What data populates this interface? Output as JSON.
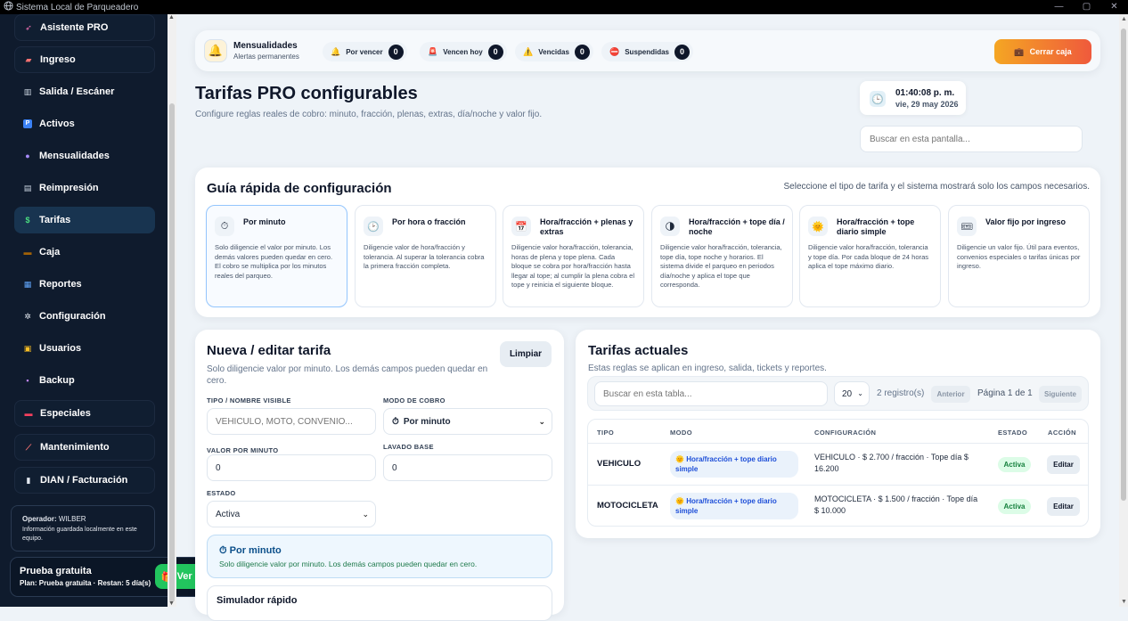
{
  "window": {
    "title": "Sistema Local de Parqueadero",
    "controls": [
      "—",
      "▢",
      "✕"
    ]
  },
  "sidebar": {
    "items": [
      {
        "label": "Asistente PRO",
        "icon": "rocket-icon"
      },
      {
        "label": "Ingreso",
        "icon": "car-icon"
      },
      {
        "label": "Salida / Escáner",
        "icon": "barcode-icon"
      },
      {
        "label": "Activos",
        "icon": "parking-icon"
      },
      {
        "label": "Mensualidades",
        "icon": "users-icon"
      },
      {
        "label": "Reimpresión",
        "icon": "printer-icon"
      },
      {
        "label": "Tarifas",
        "icon": "dollar-icon"
      },
      {
        "label": "Caja",
        "icon": "briefcase-icon"
      },
      {
        "label": "Reportes",
        "icon": "chart-icon"
      },
      {
        "label": "Configuración",
        "icon": "gear-icon"
      },
      {
        "label": "Usuarios",
        "icon": "badge-icon"
      },
      {
        "label": "Backup",
        "icon": "floppy-icon"
      },
      {
        "label": "Especiales",
        "icon": "ticket-icon"
      },
      {
        "label": "Mantenimiento",
        "icon": "broom-icon"
      },
      {
        "label": "DIAN / Facturación",
        "icon": "document-icon"
      }
    ],
    "active": "Tarifas",
    "operator": {
      "label": "Operador:",
      "name": "WILBER",
      "note": "Información guardada localmente en este equipo."
    },
    "trial": {
      "title": "Prueba gratuita",
      "detail": "Plan: Prueba gratuita · Restan: 5 día(s)",
      "button": "Ver licencia"
    }
  },
  "alerts": {
    "title": "Mensualidades",
    "subtitle": "Alertas permanentes",
    "pills": [
      {
        "label": "Por vencer",
        "count": "0"
      },
      {
        "label": "Vencen hoy",
        "count": "0"
      },
      {
        "label": "Vencidas",
        "count": "0"
      },
      {
        "label": "Suspendidas",
        "count": "0"
      }
    ],
    "close_button": "Cerrar caja"
  },
  "header": {
    "title": "Tarifas PRO configurables",
    "subtitle": "Configure reglas reales de cobro: minuto, fracción, plenas, extras, día/noche y valor fijo.",
    "time": "01:40:08 p. m.",
    "date": "vie, 29 may 2026",
    "search_placeholder": "Buscar en esta pantalla..."
  },
  "guide": {
    "title": "Guía rápida de configuración",
    "subtitle": "Seleccione el tipo de tarifa y el sistema mostrará solo los campos necesarios.",
    "options": [
      {
        "title": "Por minuto",
        "desc": "Solo diligencie el valor por minuto. Los demás valores pueden quedar en cero. El cobro se multiplica por los minutos reales del parqueo."
      },
      {
        "title": "Por hora o fracción",
        "desc": "Diligencie valor de hora/fracción y tolerancia. Al superar la tolerancia cobra la primera fracción completa."
      },
      {
        "title": "Hora/fracción + plenas y extras",
        "desc": "Diligencie valor hora/fracción, tolerancia, horas de plena y tope plena. Cada bloque se cobra por hora/fracción hasta llegar al tope; al cumplir la plena cobra el tope y reinicia el siguiente bloque."
      },
      {
        "title": "Hora/fracción + tope día / noche",
        "desc": "Diligencie valor hora/fracción, tolerancia, tope día, tope noche y horarios. El sistema divide el parqueo en periodos día/noche y aplica el tope que corresponda."
      },
      {
        "title": "Hora/fracción + tope diario simple",
        "desc": "Diligencie valor hora/fracción, tolerancia y tope día. Por cada bloque de 24 horas aplica el tope máximo diario."
      },
      {
        "title": "Valor fijo por ingreso",
        "desc": "Diligencie un valor fijo. Útil para eventos, convenios especiales o tarifas únicas por ingreso."
      }
    ]
  },
  "form": {
    "title": "Nueva / editar tarifa",
    "subtitle": "Solo diligencie valor por minuto. Los demás campos pueden quedar en cero.",
    "clear_button": "Limpiar",
    "tipo_label": "TIPO / NOMBRE VISIBLE",
    "tipo_placeholder": "VEHICULO, MOTO, CONVENIO...",
    "modo_label": "MODO DE COBRO",
    "modo_value": "Por minuto",
    "valor_label": "VALOR POR MINUTO",
    "valor_value": "0",
    "lavado_label": "LAVADO BASE",
    "lavado_value": "0",
    "estado_label": "ESTADO",
    "estado_value": "Activa",
    "hint_title": "Por minuto",
    "hint_desc": "Solo diligencie valor por minuto. Los demás campos pueden quedar en cero.",
    "simulator_title": "Simulador rápido"
  },
  "table": {
    "title": "Tarifas actuales",
    "subtitle": "Estas reglas se aplican en ingreso, salida, tickets y reportes.",
    "search_placeholder": "Buscar en esta tabla...",
    "page_size": "20",
    "records": "2 registro(s)",
    "prev": "Anterior",
    "page_info": "Página 1 de 1",
    "next": "Siguiente",
    "headers": [
      "TIPO",
      "MODO",
      "CONFIGURACIÓN",
      "ESTADO",
      "ACCIÓN"
    ],
    "rows": [
      {
        "tipo": "VEHICULO",
        "modo": "Hora/fracción + tope diario simple",
        "config": "VEHICULO · $ 2.700 / fracción · Tope día $ 16.200",
        "estado": "Activa",
        "accion": "Editar"
      },
      {
        "tipo": "MOTOCICLETA",
        "modo": "Hora/fracción + tope diario simple",
        "config": "MOTOCICLETA · $ 1.500 / fracción · Tope día $ 10.000",
        "estado": "Activa",
        "accion": "Editar"
      }
    ]
  }
}
